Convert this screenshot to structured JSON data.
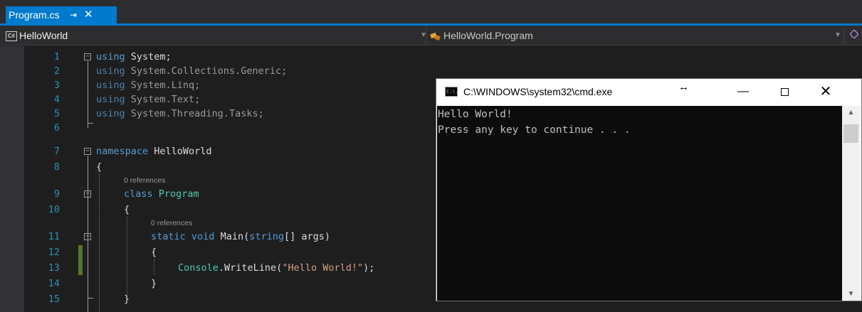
{
  "tab": {
    "title": "Program.cs",
    "pin": "⇥",
    "close": "✕"
  },
  "navbar": {
    "project_badge": "C#",
    "project": "HelloWorld",
    "type": "HelloWorld.Program"
  },
  "editor": {
    "lines": [
      {
        "num": "1"
      },
      {
        "num": "2"
      },
      {
        "num": "3"
      },
      {
        "num": "4"
      },
      {
        "num": "5"
      },
      {
        "num": "6"
      },
      {
        "num": "7"
      },
      {
        "num": "8"
      },
      {
        "num": "9"
      },
      {
        "num": "10"
      },
      {
        "num": "11"
      },
      {
        "num": "12"
      },
      {
        "num": "13"
      },
      {
        "num": "14"
      },
      {
        "num": "15"
      }
    ],
    "code": {
      "l1_kw": "using",
      "l1_rest": " System;",
      "l2_kw": "using",
      "l2_rest": " System.Collections.Generic;",
      "l3_kw": "using",
      "l3_rest": " System.Linq;",
      "l4_kw": "using",
      "l4_rest": " System.Text;",
      "l5_kw": "using",
      "l5_rest": " System.Threading.Tasks;",
      "l7_kw": "namespace",
      "l7_rest": " HelloWorld",
      "l8": "{",
      "lens1": "0 references",
      "l9_kw": "class",
      "l9_type": "Program",
      "l10": "{",
      "lens2": "0 references",
      "l11_kw1": "static",
      "l11_kw2": "void",
      "l11_name": "Main(",
      "l11_kw3": "string",
      "l11_rest": "[] args)",
      "l12": "{",
      "l13_type": "Console",
      "l13_mid": ".WriteLine(",
      "l13_str": "\"Hello World!\"",
      "l13_end": ");",
      "l14": "}",
      "l15": "}"
    }
  },
  "console_window": {
    "title": "C:\\WINDOWS\\system32\\cmd.exe",
    "icon_text": "C:\\.",
    "resize_glyph": "↔",
    "minimize": "—",
    "close": "✕",
    "output": [
      "Hello World!",
      "Press any key to continue . . ."
    ]
  }
}
